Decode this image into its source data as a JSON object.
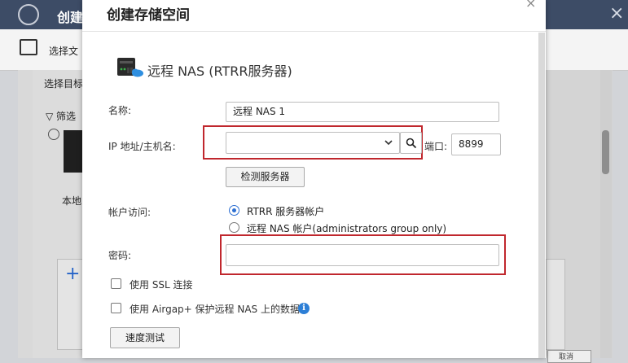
{
  "background": {
    "app_title": "创建",
    "toolbar_label": "选择文",
    "select_target": "选择目标",
    "filter_label": "筛选",
    "local_label": "本地",
    "corner_button": "取消"
  },
  "dialog": {
    "title": "创建存储空间",
    "close_glyph": "×",
    "remote_title": "远程 NAS (RTRR服务器)",
    "name_label": "名称:",
    "name_value": "远程 NAS 1",
    "ip_label": "IP 地址/主机名:",
    "ip_value": "",
    "port_label": "端口:",
    "port_value": "8899",
    "detect_button": "检测服务器",
    "account_label": "帐户访问:",
    "account_options": [
      {
        "label": "RTRR 服务器帐户",
        "selected": true
      },
      {
        "label": "远程 NAS 帐户(administrators group only)",
        "selected": false
      }
    ],
    "password_label": "密码:",
    "password_value": "",
    "ssl_label": "使用 SSL 连接",
    "airgap_label": "使用 Airgap+ 保护远程 NAS 上的数据",
    "speed_test_button": "速度测试"
  },
  "icons": {
    "dropdown": "chevron-down-icon",
    "search": "search-icon",
    "info": "info-icon",
    "nas": "nas-device-icon"
  },
  "colors": {
    "highlight": "#c0272d",
    "accent": "#2d6fd2",
    "header_bg": "#3d4c66"
  }
}
